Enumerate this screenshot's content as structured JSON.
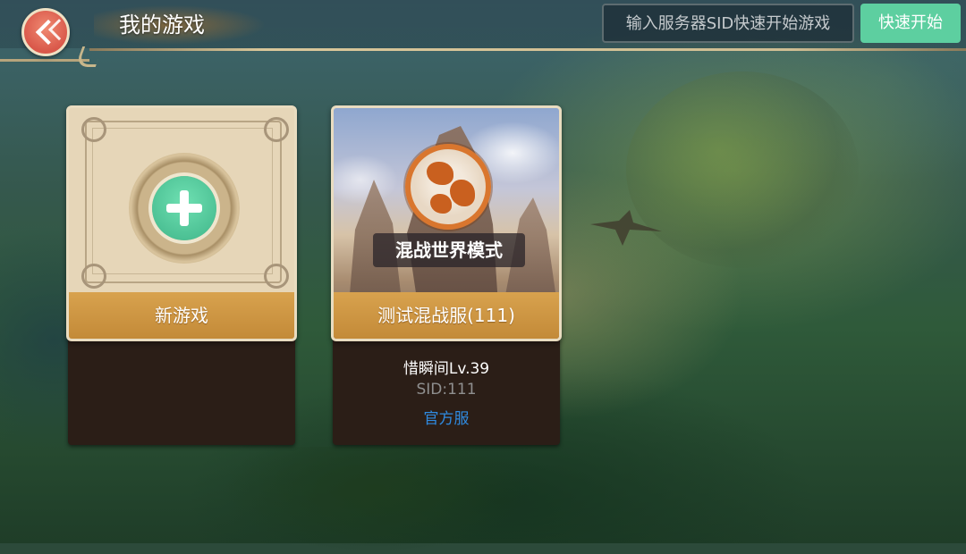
{
  "header": {
    "title": "我的游戏",
    "sid_placeholder": "输入服务器SID快速开始游戏",
    "quick_start_label": "快速开始"
  },
  "cards": [
    {
      "type": "new_game",
      "label": "新游戏"
    },
    {
      "type": "server",
      "mode_label": "混战世界模式",
      "server_name": "测试混战服(111)",
      "player": "惜瞬间Lv.39",
      "sid": "SID:111",
      "server_type": "官方服"
    }
  ],
  "colors": {
    "accent_green": "#5dcfa0",
    "back_button": "#e0614f",
    "card_label_bar": "#cf9644",
    "official_link": "#2f8ae0"
  },
  "icons": [
    "back-arrow-icon",
    "plus-icon",
    "mode-emblem-icon"
  ]
}
